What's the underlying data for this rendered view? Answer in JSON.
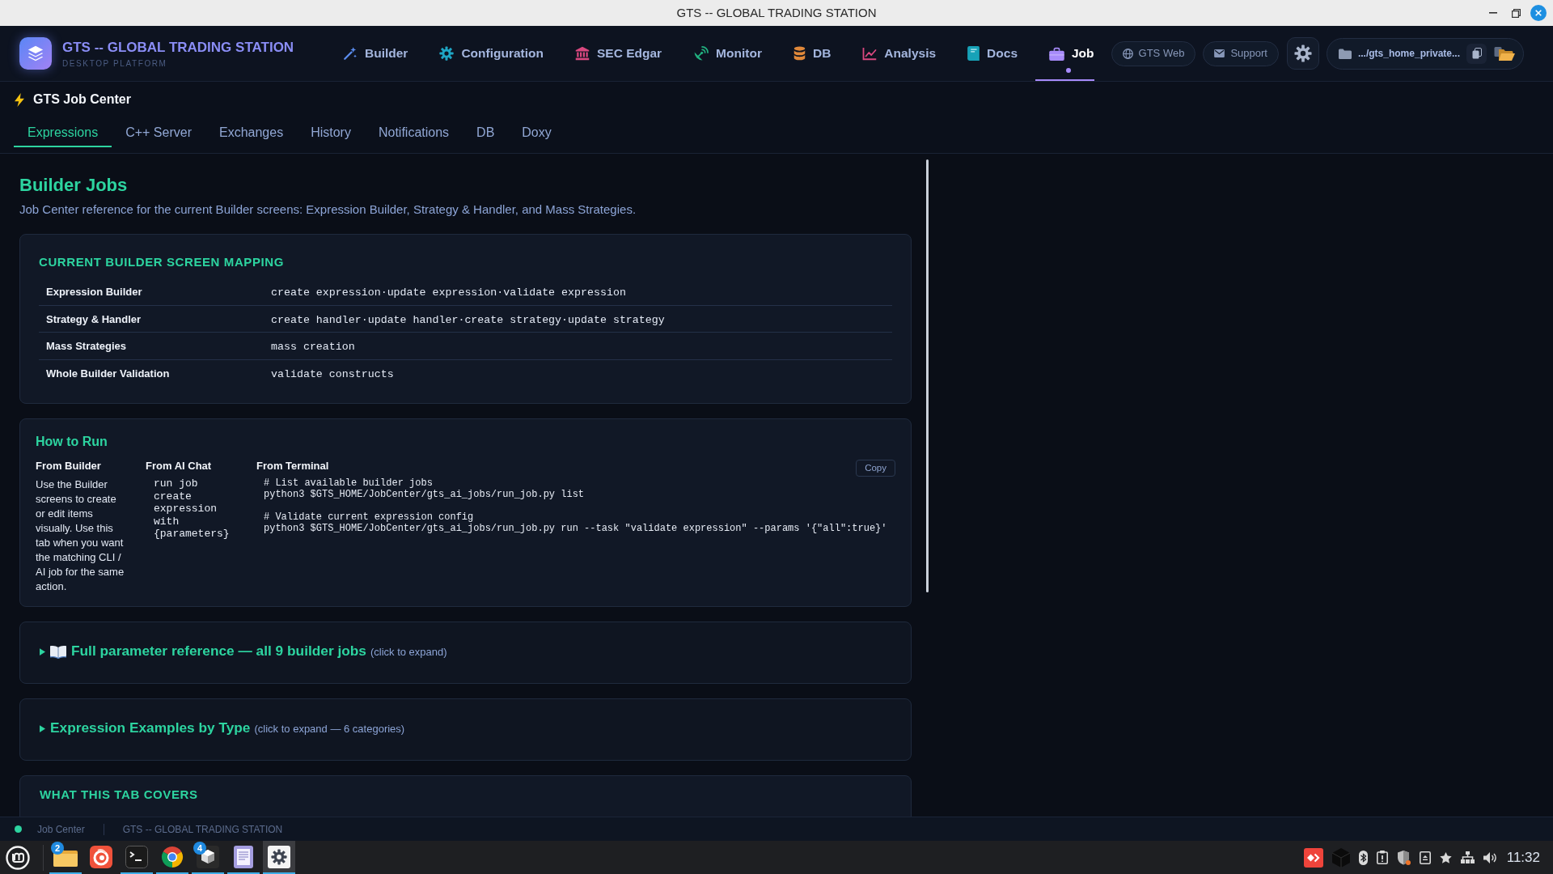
{
  "window": {
    "title": "GTS -- GLOBAL TRADING STATION"
  },
  "app_header": {
    "title": "GTS -- GLOBAL TRADING STATION",
    "subtitle": "DESKTOP PLATFORM",
    "nav": [
      {
        "label": "Builder",
        "color": "#5b8def",
        "selected": false
      },
      {
        "label": "Configuration",
        "color": "#1fa6c4",
        "selected": false
      },
      {
        "label": "SEC Edgar",
        "color": "#d9487f",
        "selected": false
      },
      {
        "label": "Monitor",
        "color": "#21b07f",
        "selected": false
      },
      {
        "label": "DB",
        "color": "#e0883a",
        "selected": false
      },
      {
        "label": "Analysis",
        "color": "#d9487f",
        "selected": false
      },
      {
        "label": "Docs",
        "color": "#17a2b8",
        "selected": false
      },
      {
        "label": "Job",
        "color": "#a78bfa",
        "selected": true
      }
    ],
    "links": [
      {
        "label": "GTS Web"
      },
      {
        "label": "Support"
      }
    ],
    "path": {
      "label": ".../gts_home_private..."
    }
  },
  "job_center": {
    "title": "GTS Job Center",
    "tabs": [
      {
        "label": "Expressions",
        "selected": true
      },
      {
        "label": "C++ Server",
        "selected": false
      },
      {
        "label": "Exchanges",
        "selected": false
      },
      {
        "label": "History",
        "selected": false
      },
      {
        "label": "Notifications",
        "selected": false
      },
      {
        "label": "DB",
        "selected": false
      },
      {
        "label": "Doxy",
        "selected": false
      }
    ]
  },
  "content": {
    "heading": "Builder Jobs",
    "description": "Job Center reference for the current Builder screens: Expression Builder, Strategy & Handler, and Mass Strategies.",
    "mapping": {
      "title": "CURRENT BUILDER SCREEN MAPPING",
      "rows": [
        {
          "screen": "Expression Builder",
          "jobs": "create expression·update expression·validate expression"
        },
        {
          "screen": "Strategy & Handler",
          "jobs": "create handler·update handler·create strategy·update strategy"
        },
        {
          "screen": "Mass Strategies",
          "jobs": "mass creation"
        },
        {
          "screen": "Whole Builder Validation",
          "jobs": "validate constructs"
        }
      ]
    },
    "how_to_run": {
      "title": "How to Run",
      "columns": [
        {
          "kind": "text",
          "heading": "From Builder",
          "text": "Use the Builder screens to create or edit items visually. Use this tab when you want the matching CLI / AI job for the same action."
        },
        {
          "kind": "code",
          "heading": "From AI Chat",
          "code": "run job create expression with {parameters}"
        },
        {
          "kind": "terminal",
          "heading": "From Terminal",
          "copy_button": "Copy",
          "blocks": [
            {
              "lines": [
                "# List available builder jobs",
                "python3 $GTS_HOME/JobCenter/gts_ai_jobs/run_job.py list"
              ]
            },
            {
              "lines": [
                "# Validate current expression config",
                "python3 $GTS_HOME/JobCenter/gts_ai_jobs/run_job.py run --task \"validate expression\" --params '{\"all\":true}'"
              ]
            }
          ]
        }
      ]
    },
    "sections": [
      {
        "title": "Full parameter reference — all 9 builder jobs",
        "hint": "(click to expand)",
        "expanded": false
      },
      {
        "title": "Expression Examples by Type",
        "hint": "(click to expand — 6 categories)",
        "expanded": false
      }
    ],
    "next_card": {
      "title": "WHAT THIS TAB COVERS"
    }
  },
  "status_bar": {
    "online": true,
    "items": [
      "Job Center",
      "GTS -- GLOBAL TRADING STATION"
    ]
  },
  "taskbar": {
    "apps": [
      {
        "badge": "2",
        "running": true,
        "selected": false
      },
      {
        "running": false,
        "selected": false
      },
      {
        "running": true,
        "selected": false
      },
      {
        "running": true,
        "selected": false
      },
      {
        "badge": "4",
        "running": true,
        "selected": false
      },
      {
        "running": true,
        "selected": false
      },
      {
        "running": true,
        "selected": true
      }
    ],
    "clock": "11:32"
  }
}
